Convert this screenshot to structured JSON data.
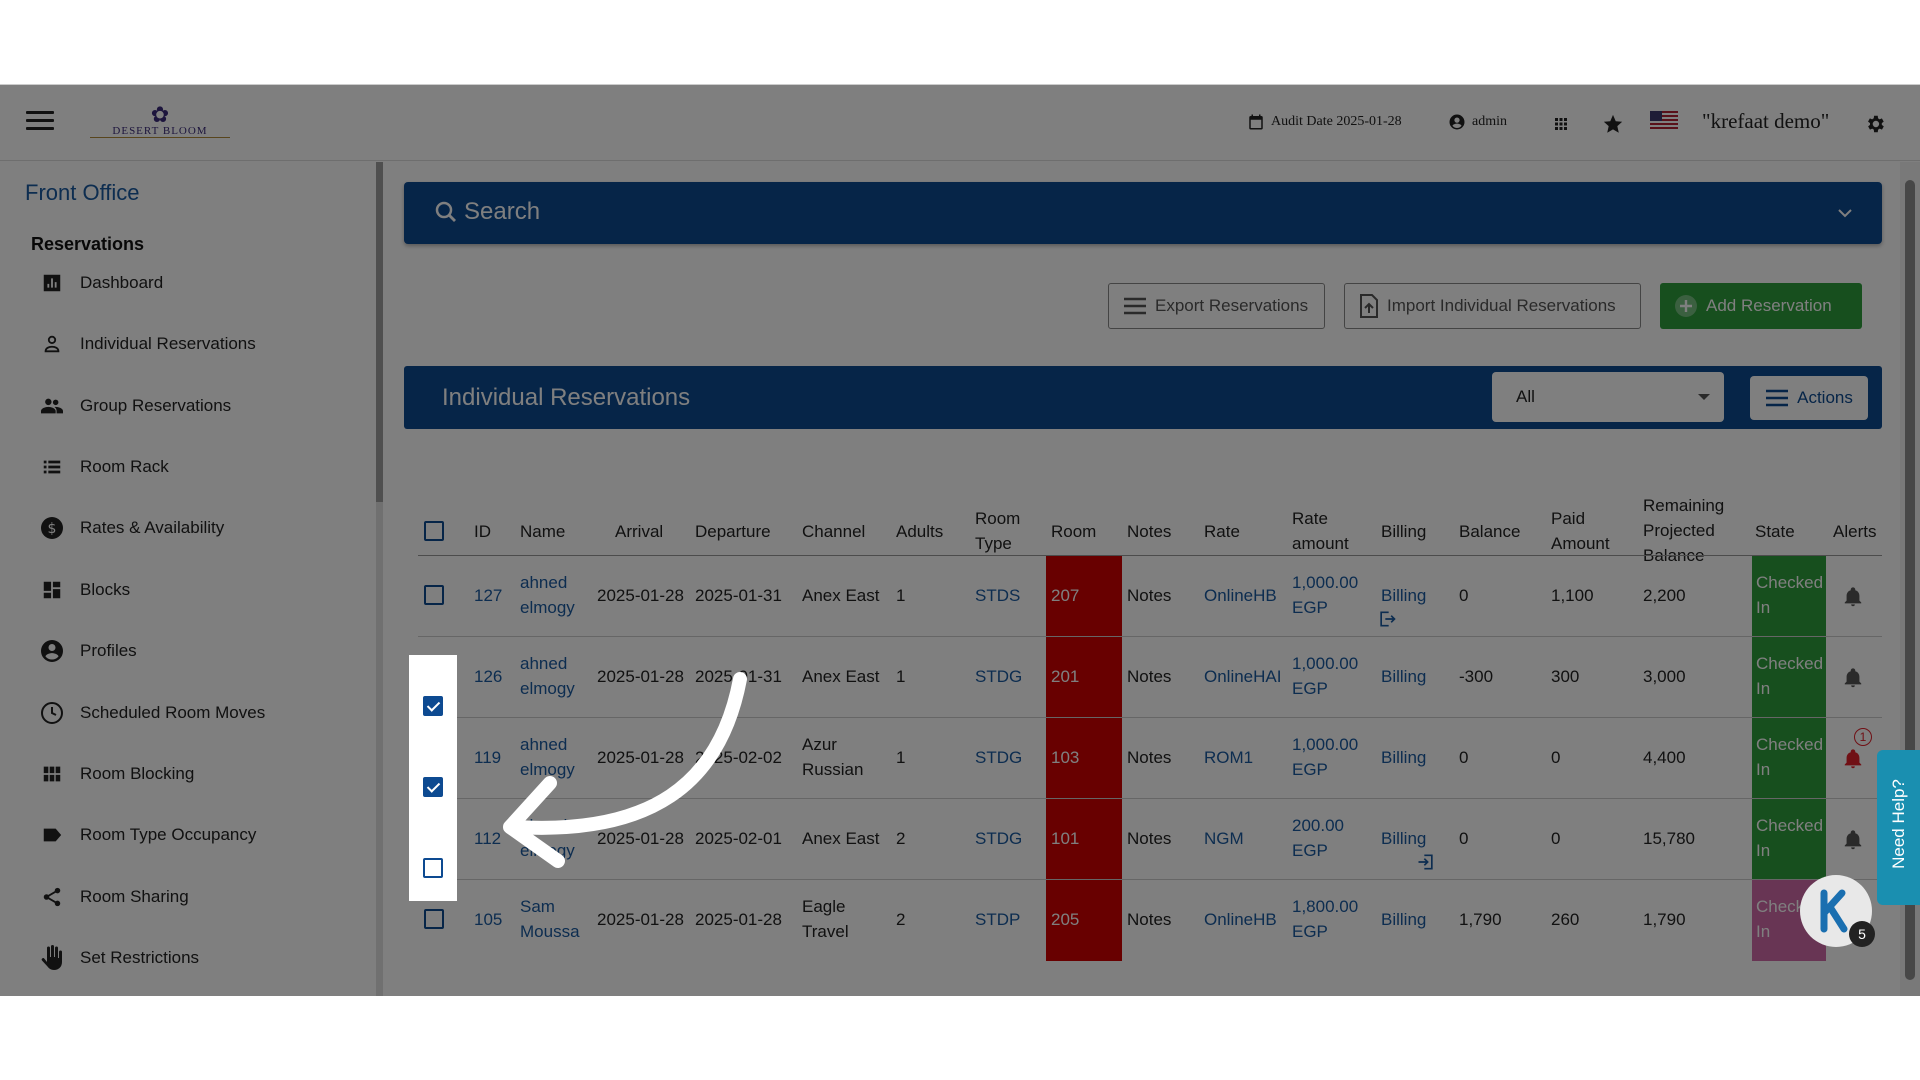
{
  "topbar": {
    "logo_text": "DESERT BLOOM",
    "audit_label": "Audit Date 2025-01-28",
    "user": "admin",
    "property": "\"krefaat demo\""
  },
  "sidebar": {
    "section": "Front Office",
    "group": "Reservations",
    "items": [
      {
        "label": "Dashboard",
        "icon": "dashboard-icon"
      },
      {
        "label": "Individual Reservations",
        "icon": "person-icon"
      },
      {
        "label": "Group Reservations",
        "icon": "group-icon"
      },
      {
        "label": "Room Rack",
        "icon": "list-icon"
      },
      {
        "label": "Rates & Availability",
        "icon": "dollar-icon"
      },
      {
        "label": "Blocks",
        "icon": "blocks-icon"
      },
      {
        "label": "Profiles",
        "icon": "profile-icon"
      },
      {
        "label": "Scheduled Room Moves",
        "icon": "clock-icon"
      },
      {
        "label": "Room Blocking",
        "icon": "grid-icon"
      },
      {
        "label": "Room Type Occupancy",
        "icon": "label-icon"
      },
      {
        "label": "Room Sharing",
        "icon": "share-icon"
      },
      {
        "label": "Set Restrictions",
        "icon": "hand-icon"
      }
    ]
  },
  "search": {
    "label": "Search"
  },
  "buttons": {
    "export": "Export Reservations",
    "import": "Import Individual Reservations",
    "add": "Add Reservation"
  },
  "panel": {
    "title": "Individual Reservations",
    "filter": "All",
    "actions": "Actions"
  },
  "table": {
    "headers": {
      "id": "ID",
      "name": "Name",
      "arrival": "Arrival",
      "departure": "Departure",
      "channel": "Channel",
      "adults": "Adults",
      "room_type_1": "Room",
      "room_type_2": "Type",
      "room": "Room",
      "notes": "Notes",
      "rate": "Rate",
      "rate_amount_1": "Rate",
      "rate_amount_2": "amount",
      "billing": "Billing",
      "balance": "Balance",
      "paid_1": "Paid",
      "paid_2": "Amount",
      "remaining_1": "Remaining",
      "remaining_2": "Projected",
      "remaining_3": "Balance",
      "state": "State",
      "alerts": "Alerts"
    },
    "rows": [
      {
        "id": "127",
        "name1": "ahned",
        "name2": "elmogy",
        "arrival": "2025-01-28",
        "departure": "2025-01-31",
        "channel1": "Anex East",
        "channel2": "",
        "adults": "1",
        "room_type": "STDS",
        "room": "207",
        "notes": "Notes",
        "rate": "OnlineHB",
        "amount1": "1,000.00",
        "amount2": "EGP",
        "billing": "Billing",
        "balance": "0",
        "paid": "1,100",
        "remaining": "2,200",
        "state1": "Checked",
        "state2": "In",
        "checked": false
      },
      {
        "id": "126",
        "name1": "ahned",
        "name2": "elmogy",
        "arrival": "2025-01-28",
        "departure": "2025-01-31",
        "channel1": "Anex East",
        "channel2": "",
        "adults": "1",
        "room_type": "STDG",
        "room": "201",
        "notes": "Notes",
        "rate": "OnlineHAI",
        "amount1": "1,000.00",
        "amount2": "EGP",
        "billing": "Billing",
        "balance": "-300",
        "paid": "300",
        "remaining": "3,000",
        "state1": "Checked",
        "state2": "In",
        "checked": true
      },
      {
        "id": "119",
        "name1": "ahned",
        "name2": "elmogy",
        "arrival": "2025-01-28",
        "departure": "2025-02-02",
        "channel1": "Azur",
        "channel2": "Russian",
        "adults": "1",
        "room_type": "STDG",
        "room": "103",
        "notes": "Notes",
        "rate": "ROM1",
        "amount1": "1,000.00",
        "amount2": "EGP",
        "billing": "Billing",
        "balance": "0",
        "paid": "0",
        "remaining": "4,400",
        "state1": "Checked",
        "state2": "In",
        "checked": true
      },
      {
        "id": "112",
        "name1": "ahned",
        "name2": "elmogy",
        "arrival": "2025-01-28",
        "departure": "2025-02-01",
        "channel1": "Anex East",
        "channel2": "",
        "adults": "2",
        "room_type": "STDG",
        "room": "101",
        "notes": "Notes",
        "rate": "NGM",
        "amount1": "200.00",
        "amount2": "EGP",
        "billing": "Billing",
        "balance": "0",
        "paid": "0",
        "remaining": "15,780",
        "state1": "Checked",
        "state2": "In",
        "checked": false
      },
      {
        "id": "105",
        "name1": "Sam",
        "name2": "Moussa",
        "arrival": "2025-01-28",
        "departure": "2025-01-28",
        "channel1": "Eagle",
        "channel2": "Travel",
        "adults": "2",
        "room_type": "STDP",
        "room": "205",
        "notes": "Notes",
        "rate": "OnlineHB",
        "amount1": "1,800.00",
        "amount2": "EGP",
        "billing": "Billing",
        "balance": "1,790",
        "paid": "260",
        "remaining": "1,790",
        "state1": "Check",
        "state2": "In",
        "checked": false
      }
    ]
  },
  "alerts_count": "1",
  "help": {
    "label": "Need Help?",
    "badge_count": "5"
  },
  "colors": {
    "primary": "#0d4a91",
    "room_red": "#d00000",
    "state_green": "#2e9e3c",
    "state_pink": "#d06aa9"
  }
}
